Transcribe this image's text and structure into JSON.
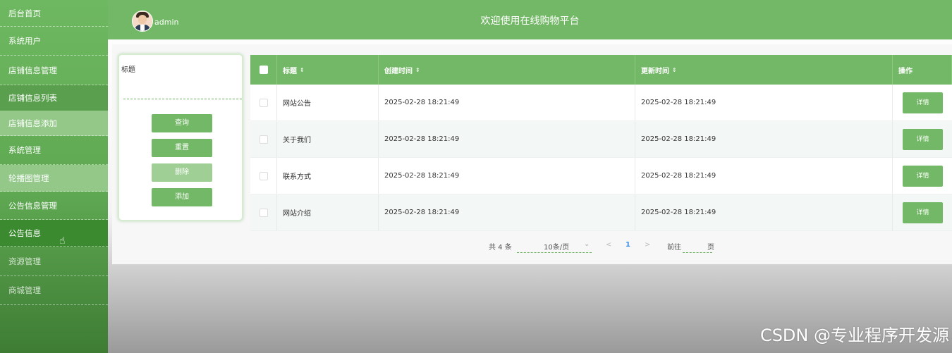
{
  "sidebar": {
    "items": [
      {
        "label": "后台首页"
      },
      {
        "label": "系统用户"
      },
      {
        "label": "店铺信息管理"
      },
      {
        "label": "店铺信息列表"
      },
      {
        "label": "店铺信息添加"
      },
      {
        "label": "系统管理"
      },
      {
        "label": "轮播图管理"
      },
      {
        "label": "公告信息管理"
      },
      {
        "label": "公告信息"
      },
      {
        "label": "资源管理"
      },
      {
        "label": "商城管理"
      }
    ]
  },
  "header": {
    "username": "admin",
    "title": "欢迎使用在线购物平台"
  },
  "search": {
    "label": "标题",
    "query_button": "查询",
    "reset_button": "重置",
    "delete_button": "删除",
    "add_button": "添加"
  },
  "table": {
    "columns": [
      "标题",
      "创建时间",
      "更新时间",
      "操作"
    ],
    "rows": [
      {
        "title": "网站公告",
        "created": "2025-02-28 18:21:49",
        "updated": "2025-02-28 18:21:49",
        "action": "详情"
      },
      {
        "title": "关于我们",
        "created": "2025-02-28 18:21:49",
        "updated": "2025-02-28 18:21:49",
        "action": "详情"
      },
      {
        "title": "联系方式",
        "created": "2025-02-28 18:21:49",
        "updated": "2025-02-28 18:21:49",
        "action": "详情"
      },
      {
        "title": "网站介绍",
        "created": "2025-02-28 18:21:49",
        "updated": "2025-02-28 18:21:49",
        "action": "详情"
      }
    ]
  },
  "pagination": {
    "total_text": "共 4 条",
    "page_size": "10条/页",
    "current_page": "1",
    "prev": "<",
    "next": ">",
    "goto_label": "前往",
    "page_suffix": "页"
  },
  "watermark": "CSDN @专业程序开发源"
}
